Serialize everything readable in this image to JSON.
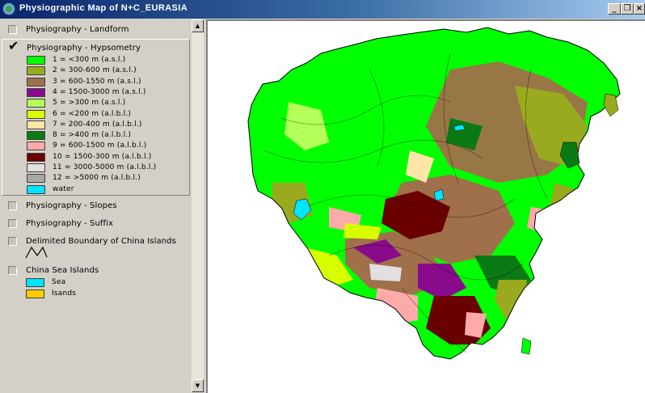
{
  "window": {
    "title": "Physiographic Map of N+C_EURASIA",
    "minimize_glyph": "_",
    "maximize_glyph": "❐",
    "close_glyph": "×"
  },
  "toc": {
    "layers": {
      "landform": {
        "label": "Physiography - Landform",
        "checked": false
      },
      "hypsometry": {
        "label": "Physiography - Hypsometry",
        "checked": true
      },
      "slopes": {
        "label": "Physiography - Slopes",
        "checked": false
      },
      "suffix": {
        "label": "Physiography - Suffix",
        "checked": false
      },
      "boundary": {
        "label": "Delimited Boundary of China Islands",
        "checked": false
      },
      "sea_islands": {
        "label": "China Sea Islands",
        "checked": false
      }
    },
    "check_glyph": "✔",
    "hypsometry_legend": [
      {
        "label": "1 = <300 m (a.s.l.)",
        "color": "#00ff00"
      },
      {
        "label": "2 = 300-600 m (a.s.l.)",
        "color": "#9aaa1e"
      },
      {
        "label": "3 = 600-1550 m (a.s.l.)",
        "color": "#a0704a"
      },
      {
        "label": "4 = 1500-3000 m (a.s.l.)",
        "color": "#8a0a8c"
      },
      {
        "label": "5 = >300 m (a.s.l.)",
        "color": "#b4ff5a"
      },
      {
        "label": "6 = <200 m (a.l.b.l.)",
        "color": "#d8ff00"
      },
      {
        "label": "7 = 200-400 m (a.l.b.l.)",
        "color": "#ffe6a8"
      },
      {
        "label": "8 = >400 m (a.l.b.l.)",
        "color": "#0a7a14"
      },
      {
        "label": "9 = 600-1500 m (a.l.b.l.)",
        "color": "#ffaaaa"
      },
      {
        "label": "10 = 1500-300 m (a.l.b.l.)",
        "color": "#6a0000"
      },
      {
        "label": "11 = 3000-5000 m (a.l.b.l.)",
        "color": "#e0e0e0"
      },
      {
        "label": "12 = >5000 m (a.l.b.l.)",
        "color": "#a8a8a8"
      },
      {
        "label": "water",
        "color": "#00e5ff"
      }
    ],
    "sea_islands_legend": [
      {
        "label": "Sea",
        "color": "#00e5ff"
      },
      {
        "label": "Isands",
        "color": "#ffcc00"
      }
    ]
  },
  "scrollbar": {
    "up_glyph": "▲",
    "down_glyph": "▼"
  }
}
